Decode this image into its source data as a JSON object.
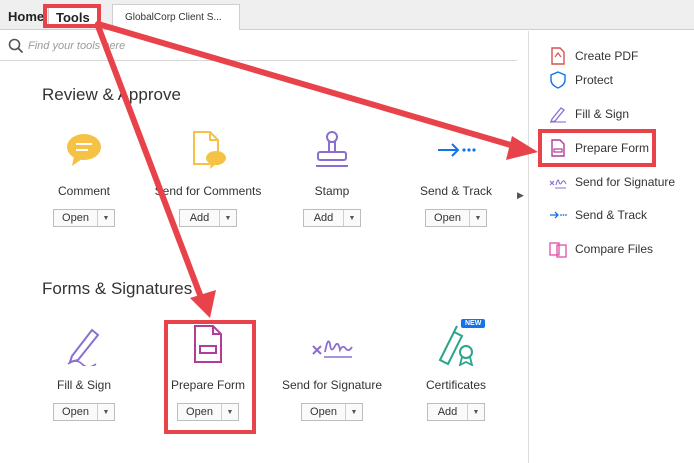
{
  "tabs": {
    "home": "Home",
    "tools": "Tools",
    "document": "GlobalCorp Client S..."
  },
  "search": {
    "placeholder": "Find your tools here"
  },
  "sections": {
    "review": "Review & Approve",
    "forms": "Forms & Signatures"
  },
  "review_tools": [
    {
      "label": "Comment",
      "button": "Open",
      "icon": "comment-icon"
    },
    {
      "label": "Send for Comments",
      "button": "Add",
      "icon": "send-for-comments-icon"
    },
    {
      "label": "Stamp",
      "button": "Add",
      "icon": "stamp-icon"
    },
    {
      "label": "Send & Track",
      "button": "Open",
      "icon": "send-track-icon"
    }
  ],
  "forms_tools": [
    {
      "label": "Fill & Sign",
      "button": "Open",
      "icon": "fill-sign-icon"
    },
    {
      "label": "Prepare Form",
      "button": "Open",
      "icon": "prepare-form-icon"
    },
    {
      "label": "Send for Signature",
      "button": "Open",
      "icon": "send-for-signature-icon"
    },
    {
      "label": "Certificates",
      "button": "Add",
      "icon": "certificates-icon",
      "badge": "NEW"
    }
  ],
  "right_panel": [
    {
      "label": "Create PDF",
      "icon": "create-pdf-icon"
    },
    {
      "label": "Protect",
      "icon": "shield-icon"
    },
    {
      "label": "Fill & Sign",
      "icon": "fill-sign-icon"
    },
    {
      "label": "Prepare Form",
      "icon": "prepare-form-icon"
    },
    {
      "label": "Send for Signature",
      "icon": "send-for-signature-icon"
    },
    {
      "label": "Send & Track",
      "icon": "send-track-icon"
    },
    {
      "label": "Compare Files",
      "icon": "compare-files-icon"
    }
  ],
  "colors": {
    "highlight": "#e8434a",
    "accent_blue": "#1473e6",
    "comment_yellow": "#f5c245",
    "purple": "#8a6fd1",
    "magenta": "#b23c96",
    "teal": "#2aa58a"
  }
}
